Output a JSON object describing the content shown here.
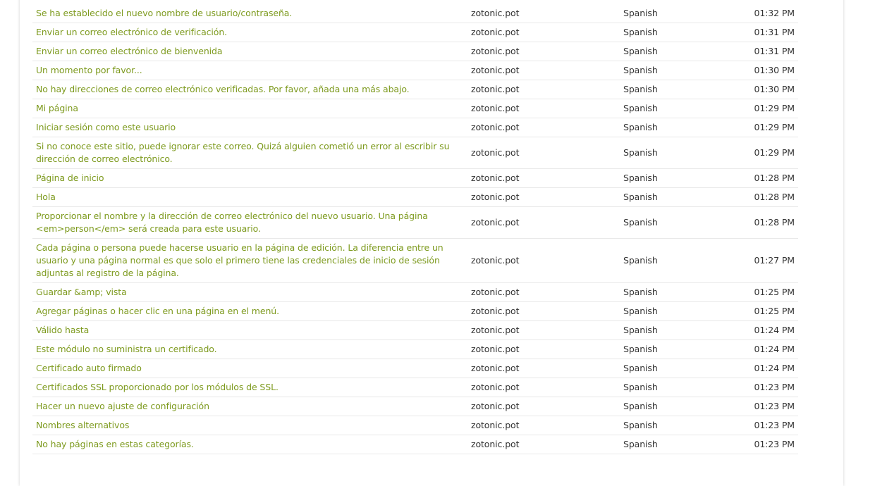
{
  "colors": {
    "link": "#7d9a1e",
    "text": "#333333",
    "row_border": "#e8e8e8"
  },
  "rows": [
    {
      "message": "Se ha establecido el nuevo nombre de usuario/contraseña.",
      "file": "zotonic.pot",
      "language": "Spanish",
      "time": "01:32 PM"
    },
    {
      "message": "Enviar un correo electrónico de verificación.",
      "file": "zotonic.pot",
      "language": "Spanish",
      "time": "01:31 PM"
    },
    {
      "message": "Enviar un correo electrónico de bienvenida",
      "file": "zotonic.pot",
      "language": "Spanish",
      "time": "01:31 PM"
    },
    {
      "message": "Un momento por favor...",
      "file": "zotonic.pot",
      "language": "Spanish",
      "time": "01:30 PM"
    },
    {
      "message": "No hay direcciones de correo electrónico verificadas. Por favor, añada una más abajo.",
      "file": "zotonic.pot",
      "language": "Spanish",
      "time": "01:30 PM"
    },
    {
      "message": "Mi página",
      "file": "zotonic.pot",
      "language": "Spanish",
      "time": "01:29 PM"
    },
    {
      "message": "Iniciar sesión como este usuario",
      "file": "zotonic.pot",
      "language": "Spanish",
      "time": "01:29 PM"
    },
    {
      "message": "Si no conoce este sitio, puede ignorar este correo. Quizá alguien cometió un error al escribir su dirección de correo electrónico.",
      "file": "zotonic.pot",
      "language": "Spanish",
      "time": "01:29 PM"
    },
    {
      "message": "Página de inicio",
      "file": "zotonic.pot",
      "language": "Spanish",
      "time": "01:28 PM"
    },
    {
      "message": "Hola",
      "file": "zotonic.pot",
      "language": "Spanish",
      "time": "01:28 PM"
    },
    {
      "message": "Proporcionar el nombre y la dirección de correo electrónico del nuevo usuario. Una página <em>person</em> será creada para este usuario.",
      "file": "zotonic.pot",
      "language": "Spanish",
      "time": "01:28 PM"
    },
    {
      "message": "Cada página o persona puede hacerse usuario en la página de edición. La diferencia entre un usuario y una página normal es que solo el primero tiene las credenciales de inicio de sesión adjuntas al registro de la página.",
      "file": "zotonic.pot",
      "language": "Spanish",
      "time": "01:27 PM"
    },
    {
      "message": "Guardar &amp; vista",
      "file": "zotonic.pot",
      "language": "Spanish",
      "time": "01:25 PM"
    },
    {
      "message": "Agregar páginas o hacer clic en una página en el menú.",
      "file": "zotonic.pot",
      "language": "Spanish",
      "time": "01:25 PM"
    },
    {
      "message": "Válido hasta",
      "file": "zotonic.pot",
      "language": "Spanish",
      "time": "01:24 PM"
    },
    {
      "message": "Este módulo no suministra un certificado.",
      "file": "zotonic.pot",
      "language": "Spanish",
      "time": "01:24 PM"
    },
    {
      "message": "Certificado auto firmado",
      "file": "zotonic.pot",
      "language": "Spanish",
      "time": "01:24 PM"
    },
    {
      "message": "Certificados SSL proporcionado por los módulos de SSL.",
      "file": "zotonic.pot",
      "language": "Spanish",
      "time": "01:23 PM"
    },
    {
      "message": "Hacer un nuevo ajuste de configuración",
      "file": "zotonic.pot",
      "language": "Spanish",
      "time": "01:23 PM"
    },
    {
      "message": "Nombres alternativos",
      "file": "zotonic.pot",
      "language": "Spanish",
      "time": "01:23 PM"
    },
    {
      "message": "No hay páginas en estas categorías.",
      "file": "zotonic.pot",
      "language": "Spanish",
      "time": "01:23 PM"
    }
  ]
}
